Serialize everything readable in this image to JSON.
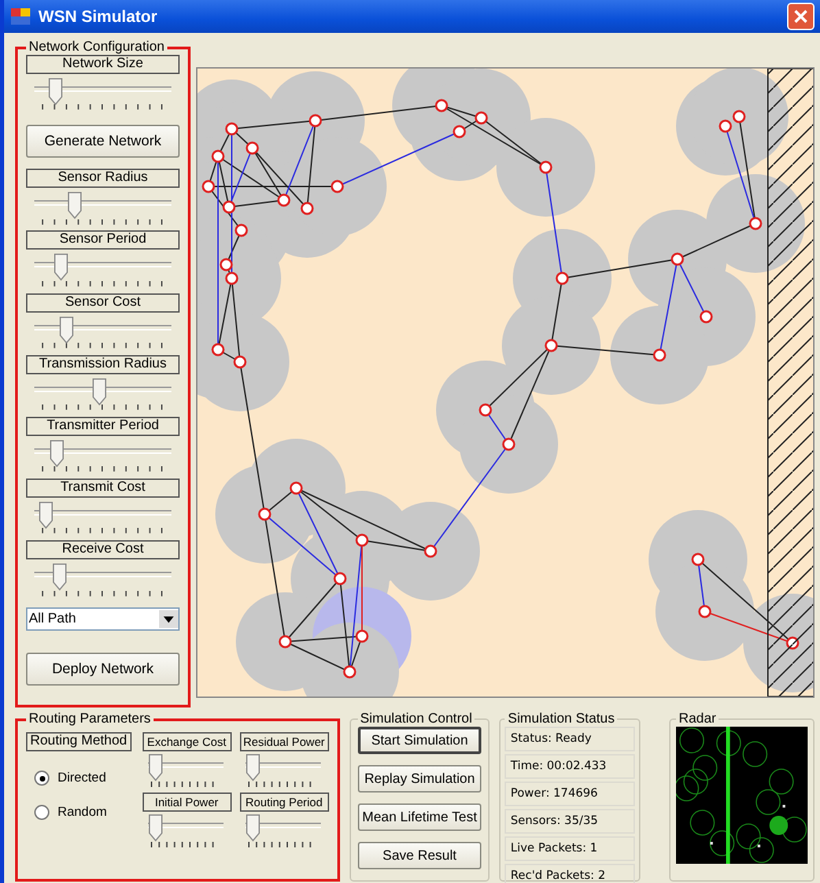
{
  "window": {
    "title": "WSN Simulator"
  },
  "network_configuration": {
    "title": "Network Configuration",
    "items": [
      {
        "kind": "slider",
        "label": "Network Size",
        "level": 0.12
      },
      {
        "kind": "button",
        "label": "Generate Network"
      },
      {
        "kind": "slider",
        "label": "Sensor Radius",
        "level": 0.3
      },
      {
        "kind": "slider",
        "label": "Sensor Period",
        "level": 0.18
      },
      {
        "kind": "slider",
        "label": "Sensor Cost",
        "level": 0.22
      },
      {
        "kind": "slider",
        "label": "Transmission Radius",
        "level": 0.52
      },
      {
        "kind": "slider",
        "label": "Transmitter Period",
        "level": 0.14
      },
      {
        "kind": "slider",
        "label": "Transmit Cost",
        "level": 0.04
      },
      {
        "kind": "slider",
        "label": "Receive Cost",
        "level": 0.16
      },
      {
        "kind": "select",
        "value": "All Path"
      },
      {
        "kind": "button",
        "label": "Deploy Network"
      }
    ]
  },
  "routing_parameters": {
    "title": "Routing Parameters",
    "method_label": "Routing Method",
    "methods": [
      {
        "label": "Directed",
        "selected": true
      },
      {
        "label": "Random",
        "selected": false
      }
    ],
    "sliders": [
      {
        "label": "Exchange Cost",
        "level": 0.0
      },
      {
        "label": "Residual Power",
        "level": 0.0
      },
      {
        "label": "Initial Power",
        "level": 0.0
      },
      {
        "label": "Routing Period",
        "level": 0.0
      }
    ]
  },
  "simulation_control": {
    "title": "Simulation Control",
    "buttons": [
      {
        "label": "Start Simulation",
        "selected": true
      },
      {
        "label": "Replay Simulation",
        "selected": false
      },
      {
        "label": "Mean Lifetime Test",
        "selected": false
      },
      {
        "label": "Save Result",
        "selected": false
      }
    ]
  },
  "simulation_status": {
    "title": "Simulation Status",
    "lines": [
      "Status: Ready",
      "Time: 00:02.433",
      "Power: 174696",
      "Sensors: 35/35",
      "Live Packets: 1",
      "Rec'd Packets: 2"
    ]
  },
  "radar": {
    "title": "Radar"
  }
}
